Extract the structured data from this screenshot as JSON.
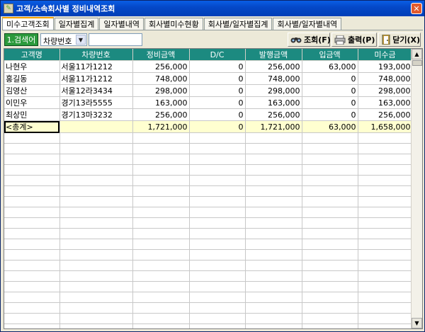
{
  "window": {
    "title": "고객/소속회사별 정비내역조회"
  },
  "tabs": [
    {
      "label": "미수고객조회",
      "active": true
    },
    {
      "label": "일자별집계",
      "active": false
    },
    {
      "label": "일자별내역",
      "active": false
    },
    {
      "label": "회사별미수현황",
      "active": false
    },
    {
      "label": "회사별/일자별집계",
      "active": false
    },
    {
      "label": "회사별/일자별내역",
      "active": false
    }
  ],
  "toolbar": {
    "search_button": "1.검색어",
    "select_value": "차량번호",
    "search_value": "",
    "query_button": "조회(F)",
    "print_button": "출력(P)",
    "close_button": "닫기(X)"
  },
  "table": {
    "columns": [
      "고객명",
      "차량번호",
      "정비금액",
      "D/C",
      "발행금액",
      "입금액",
      "미수금"
    ],
    "rows": [
      [
        "나현우",
        "서울11가1212",
        "256,000",
        "0",
        "256,000",
        "63,000",
        "193,000"
      ],
      [
        "홍길동",
        "서울11가1212",
        "748,000",
        "0",
        "748,000",
        "0",
        "748,000"
      ],
      [
        "김영산",
        "서울12라3434",
        "298,000",
        "0",
        "298,000",
        "0",
        "298,000"
      ],
      [
        "이민우",
        "경기13라5555",
        "163,000",
        "0",
        "163,000",
        "0",
        "163,000"
      ],
      [
        "최상민",
        "경기13마3232",
        "256,000",
        "0",
        "256,000",
        "0",
        "256,000"
      ]
    ],
    "total": [
      "<총계>",
      "",
      "1,721,000",
      "0",
      "1,721,000",
      "63,000",
      "1,658,000"
    ]
  }
}
